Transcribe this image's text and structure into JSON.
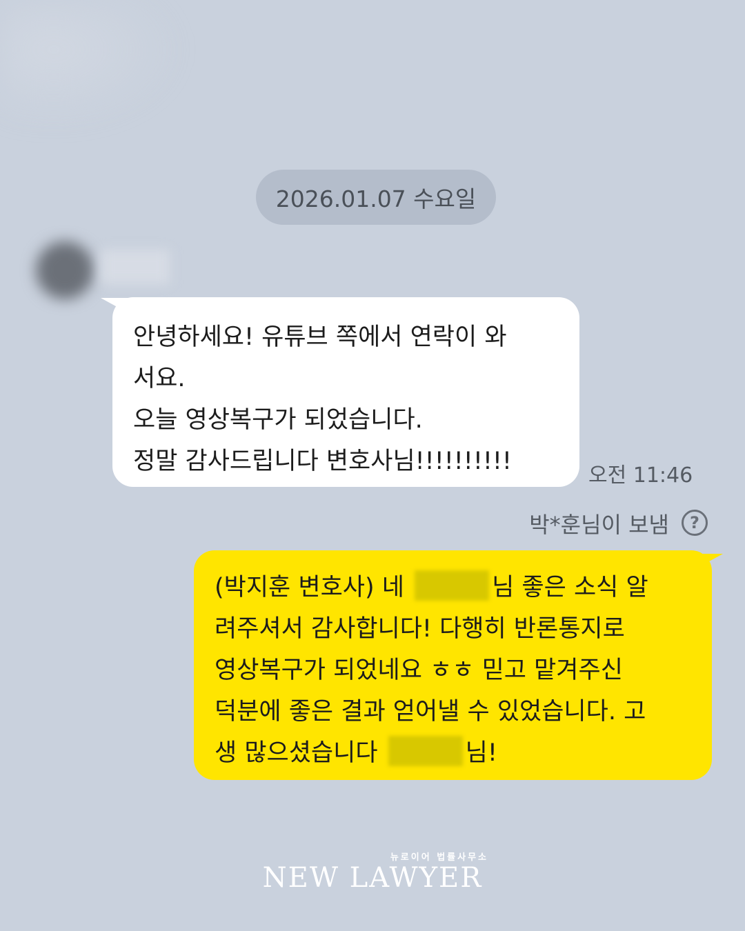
{
  "date_separator": "2026.01.07 수요일",
  "incoming": {
    "lines": [
      "안녕하세요! 유튜브 쪽에서 연락이 와",
      "서요.",
      "오늘 영상복구가 되었습니다.",
      "정말 감사드립니다 변호사님!!!!!!!!!!"
    ],
    "time": "오전 11:46"
  },
  "sent_by": "박*훈님이 보냄",
  "help_glyph": "?",
  "outgoing": {
    "line1_a": "(박지훈 변호사) 네",
    "line1_b": "님 좋은 소식 알",
    "line2": "려주셔서 감사합니다! 다행히 반론통지로",
    "line3": "영상복구가 되었네요 ㅎㅎ 믿고 맡겨주신",
    "line4": "덕분에 좋은 결과 얻어낼 수 있었습니다. 고",
    "line5_a": "생 많으셨습니다",
    "line5_b": "님!"
  },
  "logo": {
    "subtitle": "뉴로이어 법률사무소",
    "name": "NEW LAWYER"
  },
  "colors": {
    "background": "#c9d1dd",
    "incoming_bubble": "#ffffff",
    "outgoing_bubble": "#ffe500",
    "date_pill": "#b4bdcb"
  }
}
